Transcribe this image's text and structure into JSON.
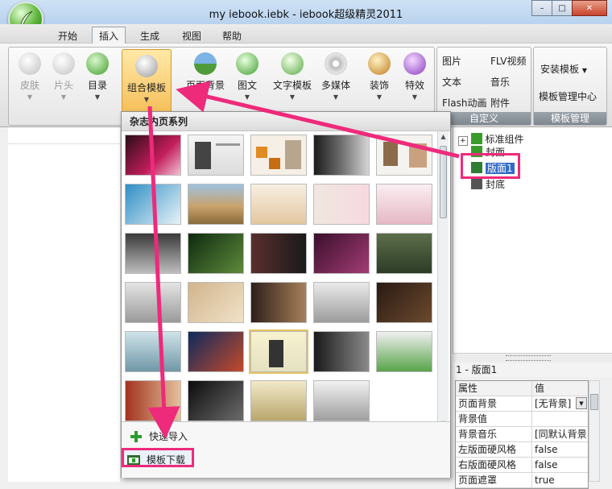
{
  "window": {
    "title": "my iebook.iebk - iebook超级精灵2011",
    "min": "–",
    "max": "□",
    "close": "✕"
  },
  "menu": {
    "tabs": [
      {
        "label": "开始"
      },
      {
        "label": "插入"
      },
      {
        "label": "生成"
      },
      {
        "label": "视图"
      },
      {
        "label": "帮助"
      }
    ]
  },
  "ribbon": {
    "buttons": [
      {
        "label": "皮肤"
      },
      {
        "label": "片头"
      },
      {
        "label": "目录"
      },
      {
        "label": "组合模板"
      },
      {
        "label": "页面背景"
      },
      {
        "label": "图文"
      },
      {
        "label": "文字模板"
      },
      {
        "label": "多媒体"
      },
      {
        "label": "装饰"
      },
      {
        "label": "特效"
      }
    ],
    "custom": {
      "image": "图片",
      "flv": "FLV视频",
      "text": "文本",
      "music": "音乐",
      "flash": "Flash动画",
      "attach": "附件",
      "group": "自定义"
    },
    "template_mgr": {
      "install": "安装模板",
      "center": "模板管理中心",
      "group": "模板管理"
    }
  },
  "gallery": {
    "heading": "杂志内页系列",
    "quick_import": "快速导入",
    "download": "模板下载"
  },
  "tree": {
    "nodes": [
      {
        "label": "标准组件"
      },
      {
        "label": "封面"
      },
      {
        "label": "版面1"
      },
      {
        "label": "封底"
      }
    ]
  },
  "properties": {
    "title": "1 - 版面1",
    "col_attr": "属性",
    "col_value": "值",
    "rows": [
      {
        "k": "页面背景",
        "v": "[无背景]"
      },
      {
        "k": "背景值",
        "v": ""
      },
      {
        "k": "背景音乐",
        "v": "[同默认背景"
      },
      {
        "k": "左版面硬风格",
        "v": "false"
      },
      {
        "k": "右版面硬风格",
        "v": "false"
      },
      {
        "k": "页面遮罩",
        "v": "true"
      }
    ]
  },
  "colors": {
    "highlight": "#ee2a7b",
    "selected_button": "#f6bf5a",
    "selection": "#316ac5"
  }
}
